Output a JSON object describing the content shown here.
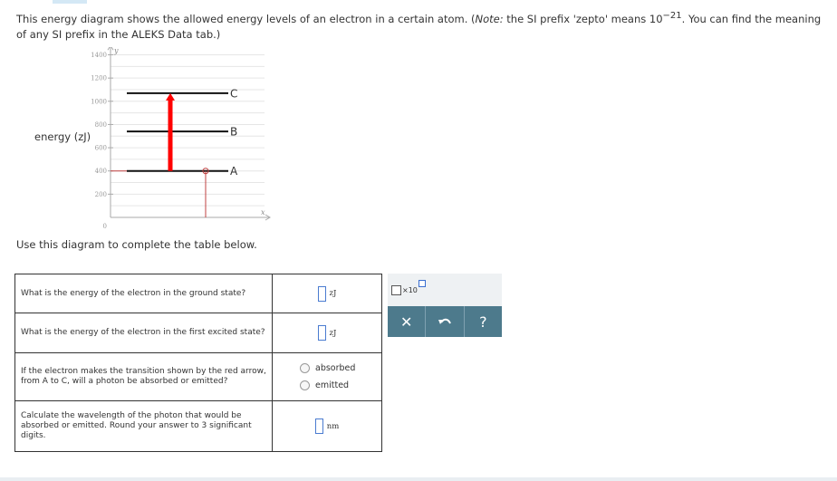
{
  "intro": {
    "text_before": "This energy diagram shows the allowed energy levels of an electron in a certain atom. (",
    "note_label": "Note:",
    "text_note": " the SI prefix 'zepto' means ",
    "base": "10",
    "exponent": "−21",
    "text_after": ". You can find the meaning of any SI prefix in the ALEKS Data tab.)"
  },
  "diagram": {
    "y_axis_label": "energy (zJ)",
    "y_axis_symbol": "y",
    "x_axis_symbol": "x",
    "origin_label": "0",
    "ticks": [
      "200",
      "400",
      "600",
      "800",
      "1000",
      "1200",
      "1400"
    ],
    "levels": [
      {
        "name": "A",
        "energy": 400
      },
      {
        "name": "B",
        "energy": 740
      },
      {
        "name": "C",
        "energy": 1070
      }
    ],
    "transition": {
      "from": "A",
      "to": "C",
      "color": "#ff0000"
    }
  },
  "instruction": "Use this diagram to complete the table below.",
  "table": {
    "rows": [
      {
        "question": "What is the energy of the electron in the ground state?",
        "unit": "zJ"
      },
      {
        "question": "What is the energy of the electron in the first excited state?",
        "unit": "zJ"
      },
      {
        "question": "If the electron makes the transition shown by the red arrow, from A to C, will a photon be absorbed or emitted?",
        "options": [
          "absorbed",
          "emitted"
        ]
      },
      {
        "question": "Calculate the wavelength of the photon that would be absorbed or emitted. Round your answer to 3 significant digits.",
        "unit": "nm"
      }
    ]
  },
  "tools": {
    "sci_label": "×10",
    "clear_icon": "✕",
    "undo_icon": "undo-icon",
    "help_label": "?"
  },
  "colors": {
    "accent": "#4d7a8c",
    "answer_box": "#4a7bd0",
    "arrow": "#ff0000"
  }
}
